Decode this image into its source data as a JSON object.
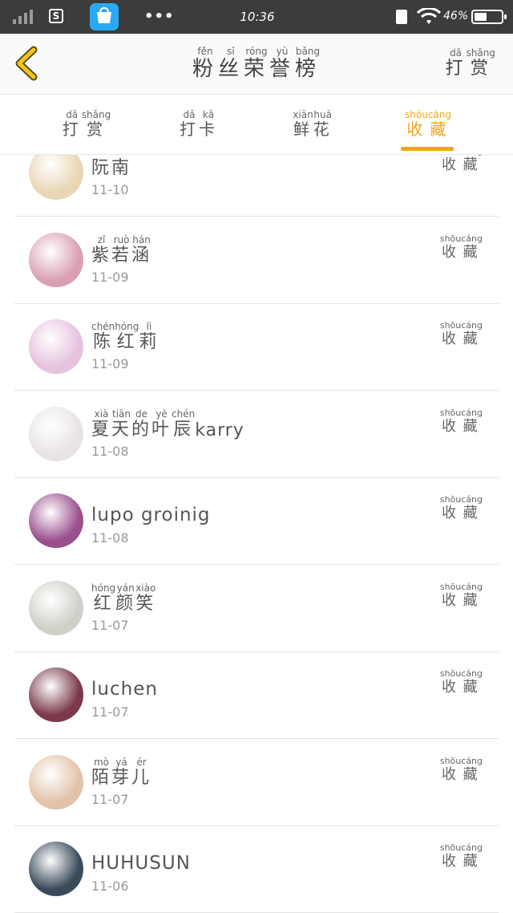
{
  "status_bar": {
    "time": "10:36",
    "battery_percent": "46%",
    "signal_icon": "signal-bars-icon",
    "app_icon": "vivo-store-icon",
    "wifi_icon": "wifi-icon",
    "charging_icon": "charging-icon",
    "battery_icon": "battery-icon",
    "battery_level": 0.46
  },
  "header": {
    "back_icon": "chevron-left-icon",
    "title": [
      {
        "char": "粉",
        "pinyin": "fěn"
      },
      {
        "char": "丝",
        "pinyin": "sī"
      },
      {
        "char": "荣",
        "pinyin": "róng"
      },
      {
        "char": "誉",
        "pinyin": "yù"
      },
      {
        "char": "榜",
        "pinyin": "bǎng"
      }
    ],
    "tip_link": [
      {
        "char": "打",
        "pinyin": "dǎ"
      },
      {
        "char": "赏",
        "pinyin": "shǎng"
      }
    ],
    "accent_color": "#f2a51a"
  },
  "tabs": [
    {
      "name": "tip",
      "chars": [
        {
          "char": "打",
          "pinyin": "dǎ"
        },
        {
          "char": "赏",
          "pinyin": "shǎng"
        }
      ],
      "active": false
    },
    {
      "name": "checkin",
      "chars": [
        {
          "char": "打",
          "pinyin": "dǎ"
        },
        {
          "char": "卡",
          "pinyin": "kǎ"
        }
      ],
      "active": false
    },
    {
      "name": "flowers",
      "chars": [
        {
          "char": "鲜",
          "pinyin": "xiān"
        },
        {
          "char": "花",
          "pinyin": "huā"
        }
      ],
      "active": false
    },
    {
      "name": "favorites",
      "chars": [
        {
          "char": "收",
          "pinyin": "shōu"
        },
        {
          "char": "藏",
          "pinyin": "cáng"
        }
      ],
      "active": true
    }
  ],
  "list": {
    "action_label": [
      {
        "char": "收",
        "pinyin": "shōu"
      },
      {
        "char": "藏",
        "pinyin": "cáng"
      }
    ],
    "items": [
      {
        "name_text": "阮南",
        "name_chars": [
          {
            "char": "阮",
            "pinyin": ""
          },
          {
            "char": "南",
            "pinyin": ""
          }
        ],
        "date": "11-10",
        "avatar_color": "#e8d6b4"
      },
      {
        "name_chars": [
          {
            "char": "紫",
            "pinyin": "zǐ"
          },
          {
            "char": "若",
            "pinyin": "ruò"
          },
          {
            "char": "涵",
            "pinyin": "hán"
          }
        ],
        "date": "11-09",
        "avatar_color": "#d9a0b4"
      },
      {
        "name_chars": [
          {
            "char": "陈",
            "pinyin": "chén"
          },
          {
            "char": "红",
            "pinyin": "hóng"
          },
          {
            "char": "莉",
            "pinyin": "lì"
          }
        ],
        "date": "11-09",
        "avatar_color": "#e6c2de"
      },
      {
        "name_chars": [
          {
            "char": "夏",
            "pinyin": "xià"
          },
          {
            "char": "天",
            "pinyin": "tiān"
          },
          {
            "char": "的",
            "pinyin": "de"
          },
          {
            "char": "叶",
            "pinyin": "yè"
          },
          {
            "char": "辰",
            "pinyin": "chén"
          }
        ],
        "name_suffix": "karry",
        "date": "11-08",
        "avatar_color": "#e9e4e4"
      },
      {
        "name_plain": "lupo groinig",
        "date": "11-08",
        "avatar_color": "#9a4f8e"
      },
      {
        "name_chars": [
          {
            "char": "红",
            "pinyin": "hóng"
          },
          {
            "char": "颜",
            "pinyin": "yán"
          },
          {
            "char": "笑",
            "pinyin": "xiào"
          }
        ],
        "date": "11-07",
        "avatar_color": "#d0cfc8"
      },
      {
        "name_plain": "luchen",
        "date": "11-07",
        "avatar_color": "#7a3a4a"
      },
      {
        "name_chars": [
          {
            "char": "陌",
            "pinyin": "mò"
          },
          {
            "char": "芽",
            "pinyin": "yá"
          },
          {
            "char": "儿",
            "pinyin": "ér"
          }
        ],
        "date": "11-07",
        "avatar_color": "#e2c3aa"
      },
      {
        "name_plain": "HUHUSUN",
        "date": "11-06",
        "avatar_color": "#3a4a5a"
      }
    ]
  }
}
